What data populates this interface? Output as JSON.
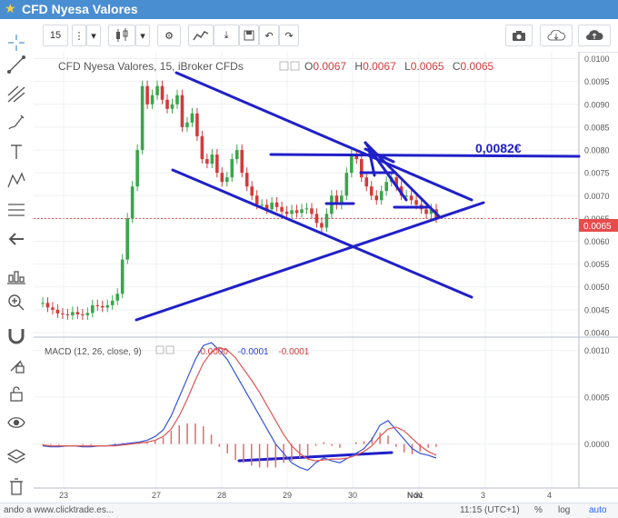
{
  "window": {
    "title": "CFD Nyesa Valores"
  },
  "toolbar": {
    "interval": "15"
  },
  "chart_data": [
    {
      "type": "candlestick",
      "title": "CFD Nyesa Valores, 15, iBroker CFDs",
      "ohlc_labels": [
        "O",
        "H",
        "L",
        "C"
      ],
      "ohlc_values": [
        "0.0067",
        "0.0067",
        "0.0065",
        "0.0065"
      ],
      "last_price_label": "0.0065",
      "y_ticks": [
        "0.0100",
        "0.0095",
        "0.0090",
        "0.0085",
        "0.0080",
        "0.0075",
        "0.0070",
        "0.0065",
        "0.0060",
        "0.0055",
        "0.0050",
        "0.0045",
        "0.0040"
      ],
      "ylim": [
        0.0039,
        0.01015
      ],
      "x_ticks": [
        "23",
        "27",
        "28",
        "29",
        "30",
        "31",
        "3",
        "4",
        "Nov"
      ],
      "annotation": "0,0082€",
      "close_series": [
        0.00465,
        0.00455,
        0.0045,
        0.00442,
        0.0044,
        0.00438,
        0.00445,
        0.0044,
        0.00438,
        0.00443,
        0.0046,
        0.00458,
        0.00455,
        0.0046,
        0.0047,
        0.00485,
        0.0056,
        0.0065,
        0.0072,
        0.008,
        0.0094,
        0.009,
        0.0092,
        0.0094,
        0.0091,
        0.0089,
        0.009,
        0.0092,
        0.0085,
        0.0086,
        0.0088,
        0.0083,
        0.0078,
        0.0077,
        0.0079,
        0.0075,
        0.0073,
        0.0074,
        0.0078,
        0.008,
        0.0075,
        0.0072,
        0.007,
        0.0068,
        0.0068,
        0.0067,
        0.00685,
        0.00675,
        0.00665,
        0.0066,
        0.00668,
        0.00662,
        0.0067,
        0.00672,
        0.0066,
        0.0064,
        0.0063,
        0.0066,
        0.007,
        0.0068,
        0.007,
        0.0075,
        0.0079,
        0.0078,
        0.0074,
        0.0072,
        0.007,
        0.0069,
        0.0071,
        0.0073,
        0.0074,
        0.0072,
        0.007,
        0.007,
        0.0069,
        0.0068,
        0.0067,
        0.0066,
        0.0067,
        0.0065
      ]
    },
    {
      "type": "line",
      "title": "MACD (12, 26, close, 9)",
      "legend_values": [
        "-0.0000",
        "-0.0001",
        "-0.0001"
      ],
      "y_ticks": [
        "0.0010",
        "0.0005",
        "0.0000"
      ],
      "ylim": [
        -0.00045,
        0.00112
      ],
      "series": [
        {
          "values": [
            -2e-05,
            -3e-05,
            -3e-05,
            -2e-05,
            -2e-05,
            -3e-05,
            -3e-05,
            -2e-05,
            -2e-05,
            -1e-05,
            0.0,
            1e-05,
            2e-05,
            4e-05,
            8e-05,
            0.00015,
            0.0003,
            0.0005,
            0.0007,
            0.0009,
            0.00105,
            0.00108,
            0.001,
            0.0009,
            0.00075,
            0.0006,
            0.00045,
            0.0003,
            0.00015,
            0.0,
            -0.0001,
            -0.0002,
            -0.00025,
            -0.00028,
            -0.0002,
            -0.00015,
            -0.00018,
            -0.0002,
            -0.00015,
            -0.0001,
            -5e-05,
            5e-05,
            0.0002,
            0.00025,
            0.00015,
            5e-05,
            -5e-05,
            -0.0001,
            -0.00012,
            -0.00015
          ]
        },
        {
          "values": [
            -1e-05,
            -2e-05,
            -2e-05,
            -2e-05,
            -2e-05,
            -2e-05,
            -2e-05,
            -2e-05,
            -2e-05,
            -2e-05,
            -1e-05,
            0.0,
            1e-05,
            2e-05,
            4e-05,
            8e-05,
            0.00016,
            0.0003,
            0.00048,
            0.00068,
            0.00086,
            0.00098,
            0.00103,
            0.001,
            0.00092,
            0.0008,
            0.00068,
            0.00055,
            0.0004,
            0.00025,
            0.0001,
            -2e-05,
            -0.0001,
            -0.00016,
            -0.00018,
            -0.00017,
            -0.00016,
            -0.00016,
            -0.00015,
            -0.00012,
            -8e-05,
            -2e-05,
            8e-05,
            0.00016,
            0.00018,
            0.00014,
            6e-05,
            -2e-05,
            -8e-05,
            -0.00012
          ]
        }
      ],
      "histogram": [
        -1e-05,
        -1e-05,
        -1e-05,
        0.0,
        0.0,
        -1e-05,
        -1e-05,
        0.0,
        0.0,
        1e-05,
        1e-05,
        1e-05,
        1e-05,
        2e-05,
        4e-05,
        7e-05,
        0.00014,
        0.0002,
        0.00022,
        0.00022,
        0.00019,
        0.0001,
        -3e-05,
        -0.0001,
        -0.00017,
        -0.0002,
        -0.00023,
        -0.00025,
        -0.00025,
        -0.00025,
        -0.0002,
        -0.00018,
        -0.00015,
        -0.00012,
        -2e-05,
        2e-05,
        -2e-05,
        -4e-05,
        0.0,
        2e-05,
        3e-05,
        7e-05,
        0.00012,
        9e-05,
        -3e-05,
        -9e-05,
        -0.00011,
        -8e-05,
        -4e-05,
        -3e-05
      ]
    }
  ],
  "statusbar": {
    "left_text": "ando a www.clicktrade.es...",
    "time": "11:15 (UTC+1)",
    "percent": "%",
    "log": "log",
    "auto": "auto"
  }
}
